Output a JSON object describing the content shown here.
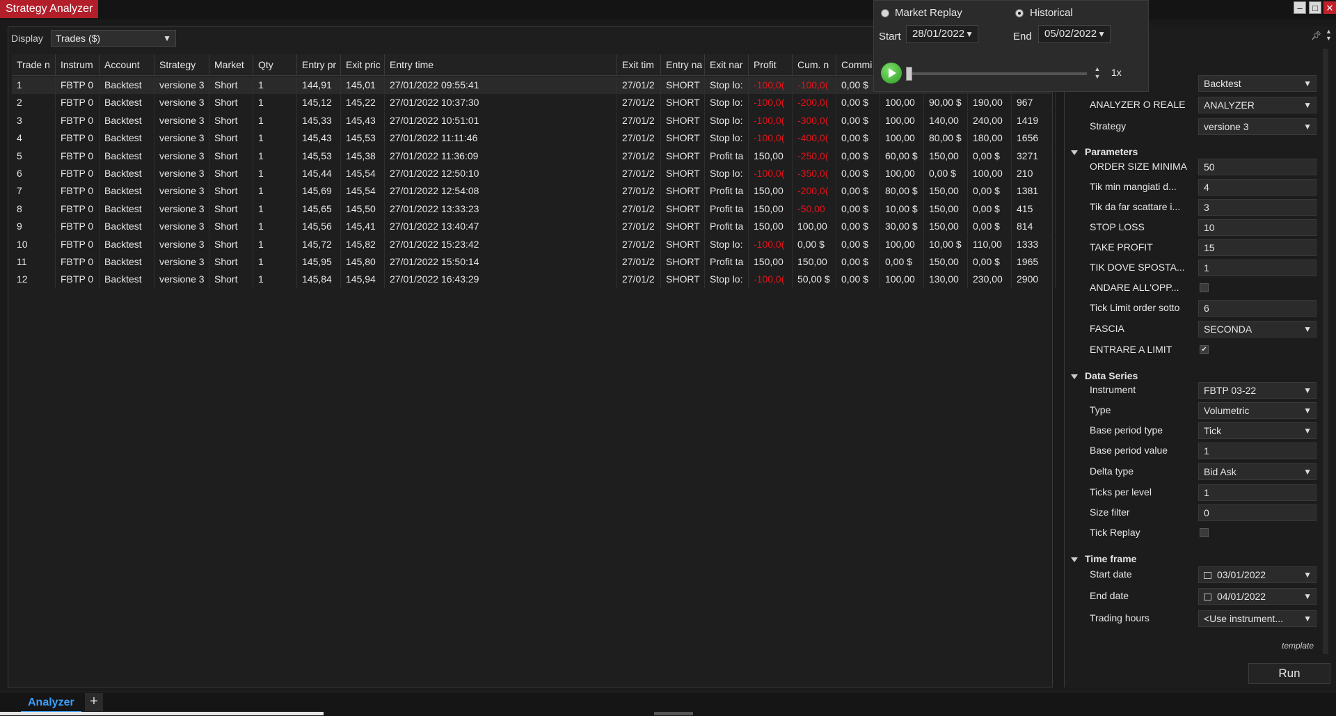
{
  "window": {
    "title": "Strategy Analyzer",
    "min_icon": "minimize-icon",
    "max_icon": "maximize-icon",
    "close_icon": "close-icon"
  },
  "toolbar": {
    "display_label": "Display",
    "display_value": "Trades ($)"
  },
  "grid": {
    "columns": [
      "Trade n",
      "Instrum",
      "Account",
      "Strategy",
      "Market",
      "Qty",
      "Entry pr",
      "Exit pric",
      "Entry time",
      "Exit tim",
      "Entry na",
      "Exit nar",
      "Profit",
      "Cum. n",
      "Commi",
      "",
      "",
      "",
      ""
    ],
    "rows": [
      [
        "1",
        "FBTP 0",
        "Backtest",
        "versione 3",
        "Short",
        "1",
        "144,91",
        "145,01",
        "27/01/2022 09:55:41",
        "27/01/2",
        "SHORT",
        "Stop lo:",
        "-100,0(",
        "-100,0(",
        "0,00 $",
        "",
        "",
        "",
        ""
      ],
      [
        "2",
        "FBTP 0",
        "Backtest",
        "versione 3",
        "Short",
        "1",
        "145,12",
        "145,22",
        "27/01/2022 10:37:30",
        "27/01/2",
        "SHORT",
        "Stop lo:",
        "-100,0(",
        "-200,0(",
        "0,00 $",
        "100,00",
        "90,00 $",
        "190,00",
        "967"
      ],
      [
        "3",
        "FBTP 0",
        "Backtest",
        "versione 3",
        "Short",
        "1",
        "145,33",
        "145,43",
        "27/01/2022 10:51:01",
        "27/01/2",
        "SHORT",
        "Stop lo:",
        "-100,0(",
        "-300,0(",
        "0,00 $",
        "100,00",
        "140,00",
        "240,00",
        "1419"
      ],
      [
        "4",
        "FBTP 0",
        "Backtest",
        "versione 3",
        "Short",
        "1",
        "145,43",
        "145,53",
        "27/01/2022 11:11:46",
        "27/01/2",
        "SHORT",
        "Stop lo:",
        "-100,0(",
        "-400,0(",
        "0,00 $",
        "100,00",
        "80,00 $",
        "180,00",
        "1656"
      ],
      [
        "5",
        "FBTP 0",
        "Backtest",
        "versione 3",
        "Short",
        "1",
        "145,53",
        "145,38",
        "27/01/2022 11:36:09",
        "27/01/2",
        "SHORT",
        "Profit ta",
        "150,00",
        "-250,0(",
        "0,00 $",
        "60,00 $",
        "150,00",
        "0,00 $",
        "3271"
      ],
      [
        "6",
        "FBTP 0",
        "Backtest",
        "versione 3",
        "Short",
        "1",
        "145,44",
        "145,54",
        "27/01/2022 12:50:10",
        "27/01/2",
        "SHORT",
        "Stop lo:",
        "-100,0(",
        "-350,0(",
        "0,00 $",
        "100,00",
        "0,00 $",
        "100,00",
        "210"
      ],
      [
        "7",
        "FBTP 0",
        "Backtest",
        "versione 3",
        "Short",
        "1",
        "145,69",
        "145,54",
        "27/01/2022 12:54:08",
        "27/01/2",
        "SHORT",
        "Profit ta",
        "150,00",
        "-200,0(",
        "0,00 $",
        "80,00 $",
        "150,00",
        "0,00 $",
        "1381"
      ],
      [
        "8",
        "FBTP 0",
        "Backtest",
        "versione 3",
        "Short",
        "1",
        "145,65",
        "145,50",
        "27/01/2022 13:33:23",
        "27/01/2",
        "SHORT",
        "Profit ta",
        "150,00",
        "-50,00",
        "0,00 $",
        "10,00 $",
        "150,00",
        "0,00 $",
        "415"
      ],
      [
        "9",
        "FBTP 0",
        "Backtest",
        "versione 3",
        "Short",
        "1",
        "145,56",
        "145,41",
        "27/01/2022 13:40:47",
        "27/01/2",
        "SHORT",
        "Profit ta",
        "150,00",
        "100,00",
        "0,00 $",
        "30,00 $",
        "150,00",
        "0,00 $",
        "814"
      ],
      [
        "10",
        "FBTP 0",
        "Backtest",
        "versione 3",
        "Short",
        "1",
        "145,72",
        "145,82",
        "27/01/2022 15:23:42",
        "27/01/2",
        "SHORT",
        "Stop lo:",
        "-100,0(",
        "0,00 $",
        "0,00 $",
        "100,00",
        "10,00 $",
        "110,00",
        "1333"
      ],
      [
        "11",
        "FBTP 0",
        "Backtest",
        "versione 3",
        "Short",
        "1",
        "145,95",
        "145,80",
        "27/01/2022 15:50:14",
        "27/01/2",
        "SHORT",
        "Profit ta",
        "150,00",
        "150,00",
        "0,00 $",
        "0,00 $",
        "150,00",
        "0,00 $",
        "1965"
      ],
      [
        "12",
        "FBTP 0",
        "Backtest",
        "versione 3",
        "Short",
        "1",
        "145,84",
        "145,94",
        "27/01/2022 16:43:29",
        "27/01/2",
        "SHORT",
        "Stop lo:",
        "-100,0(",
        "50,00 $",
        "0,00 $",
        "100,00",
        "130,00",
        "230,00",
        "2900"
      ]
    ],
    "negative_color": "#e3131b"
  },
  "replay": {
    "market_replay_label": "Market Replay",
    "historical_label": "Historical",
    "start_label": "Start",
    "start_value": "28/01/2022",
    "end_label": "End",
    "end_value": "05/02/2022",
    "speed_label": "1x"
  },
  "properties": {
    "general": [
      {
        "label": "",
        "value": "Backtest",
        "type": "select"
      },
      {
        "label": "ANALYZER O REALE",
        "value": "ANALYZER",
        "type": "select"
      },
      {
        "label": "Strategy",
        "value": "versione 3",
        "type": "select"
      }
    ],
    "parameters_title": "Parameters",
    "parameters": [
      {
        "label": "ORDER SIZE MINIMA",
        "value": "50",
        "type": "text"
      },
      {
        "label": "Tik min mangiati d...",
        "value": "4",
        "type": "text"
      },
      {
        "label": "Tik da far scattare i...",
        "value": "3",
        "type": "text"
      },
      {
        "label": "STOP LOSS",
        "value": "10",
        "type": "text"
      },
      {
        "label": "TAKE PROFIT",
        "value": "15",
        "type": "text"
      },
      {
        "label": "TIK DOVE SPOSTA...",
        "value": "1",
        "type": "text"
      },
      {
        "label": "ANDARE ALL'OPP...",
        "value": "",
        "type": "check"
      },
      {
        "label": "Tick Limit order sotto",
        "value": "6",
        "type": "text"
      },
      {
        "label": "FASCIA",
        "value": "SECONDA",
        "type": "select"
      },
      {
        "label": "ENTRARE A LIMIT",
        "value": "✔",
        "type": "check"
      }
    ],
    "data_series_title": "Data Series",
    "data_series": [
      {
        "label": "Instrument",
        "value": "FBTP 03-22",
        "type": "select"
      },
      {
        "label": "Type",
        "value": "Volumetric",
        "type": "select"
      },
      {
        "label": "Base period type",
        "value": "Tick",
        "type": "select"
      },
      {
        "label": "Base period value",
        "value": "1",
        "type": "text"
      },
      {
        "label": "Delta type",
        "value": "Bid Ask",
        "type": "select"
      },
      {
        "label": "Ticks per level",
        "value": "1",
        "type": "text"
      },
      {
        "label": "Size filter",
        "value": "0",
        "type": "text"
      },
      {
        "label": "Tick Replay",
        "value": "",
        "type": "check"
      }
    ],
    "time_frame_title": "Time frame",
    "time_frame": [
      {
        "label": "Start date",
        "value": "03/01/2022",
        "type": "date"
      },
      {
        "label": "End date",
        "value": "04/01/2022",
        "type": "date"
      },
      {
        "label": "Trading hours",
        "value": "<Use instrument...",
        "type": "select"
      }
    ],
    "template_label": "template",
    "run_label": "Run"
  },
  "bottom": {
    "tab_label": "Analyzer",
    "add_label": "+"
  }
}
